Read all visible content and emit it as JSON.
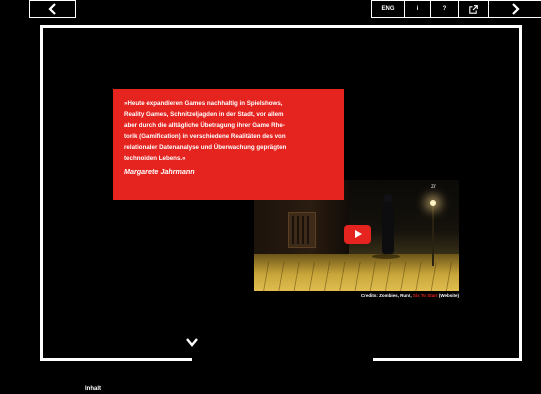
{
  "quote": {
    "lines": [
      "»Heute expandieren Games nachhaltig in Spielshows,",
      "Reality Games, Schnitzeljagden in der Stadt, vor allem",
      "aber durch die alltägliche Übetragung ihrer Game Rhe-",
      "torik (Gamification) in verschiedene Realitäten des von",
      "relationaler Datenanalyse und Überwachung geprägten",
      "technoiden Lebens.«"
    ],
    "author": "Margarete Jahrmann"
  },
  "video": {
    "credits_prefix": "Credits: Zombies, Run!,",
    "credits_link": "Six To Start",
    "credits_suffix": "(Website)",
    "watermark": "zr"
  },
  "bottombar": {
    "contents_label": "Inhalt",
    "language_label": "ENG",
    "info_label": "i",
    "help_label": "?"
  },
  "icons": {
    "prev": "chevron-left-icon",
    "next": "chevron-right-icon",
    "scroll_down": "chevron-down-icon",
    "share": "external-link-icon"
  },
  "colors": {
    "accent": "#e5231f",
    "background": "#000000",
    "frame": "#ffffff"
  }
}
